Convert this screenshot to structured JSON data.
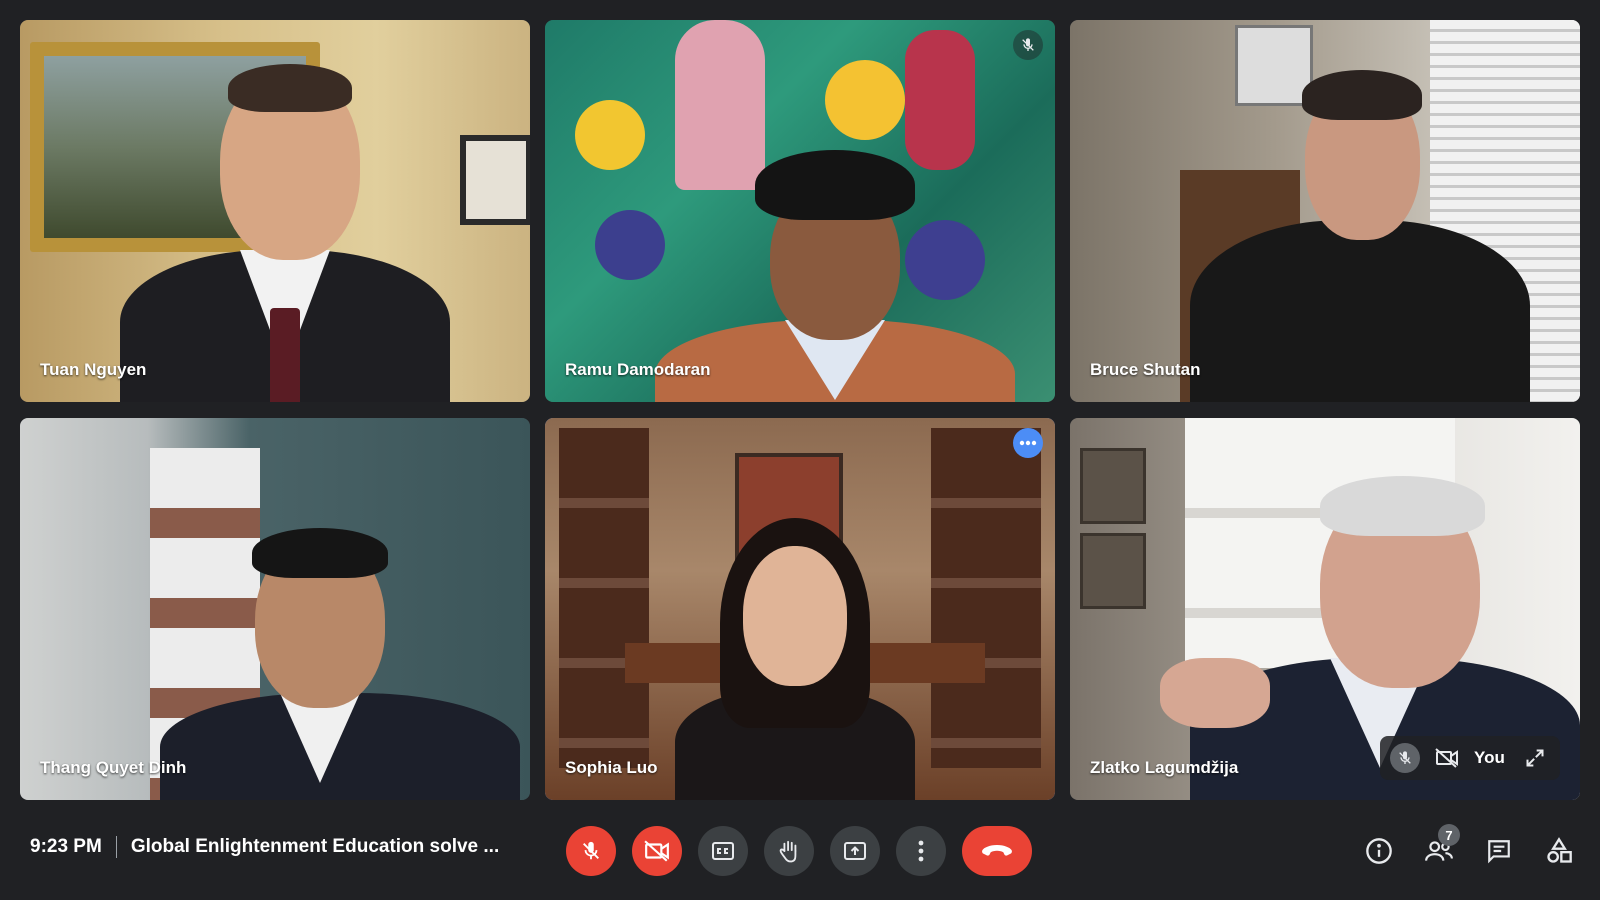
{
  "tiles": [
    {
      "name": "Tuan Nguyen",
      "muted": false
    },
    {
      "name": "Ramu Damodaran",
      "muted": true
    },
    {
      "name": "Bruce Shutan",
      "muted": false
    },
    {
      "name": "Thang Quyet Dinh",
      "muted": false
    },
    {
      "name": "Sophia Luo",
      "muted": false,
      "active_speaker": true
    },
    {
      "name": "Zlatko Lagumdžija",
      "muted": false,
      "self_label": "You"
    }
  ],
  "meeting": {
    "time": "9:23 PM",
    "title": "Global Enlightenment Education solve ..."
  },
  "controls": {
    "mic": "mic-off-icon",
    "camera": "camera-off-icon",
    "captions": "captions-icon",
    "raise_hand": "hand-icon",
    "present": "present-icon",
    "more": "more-vert-icon",
    "leave": "end-call-icon"
  },
  "side": {
    "participants_count": "7"
  },
  "colors": {
    "background": "#202124",
    "button": "#3c4043",
    "danger": "#ea4335",
    "active_border": "#4c8df6"
  }
}
